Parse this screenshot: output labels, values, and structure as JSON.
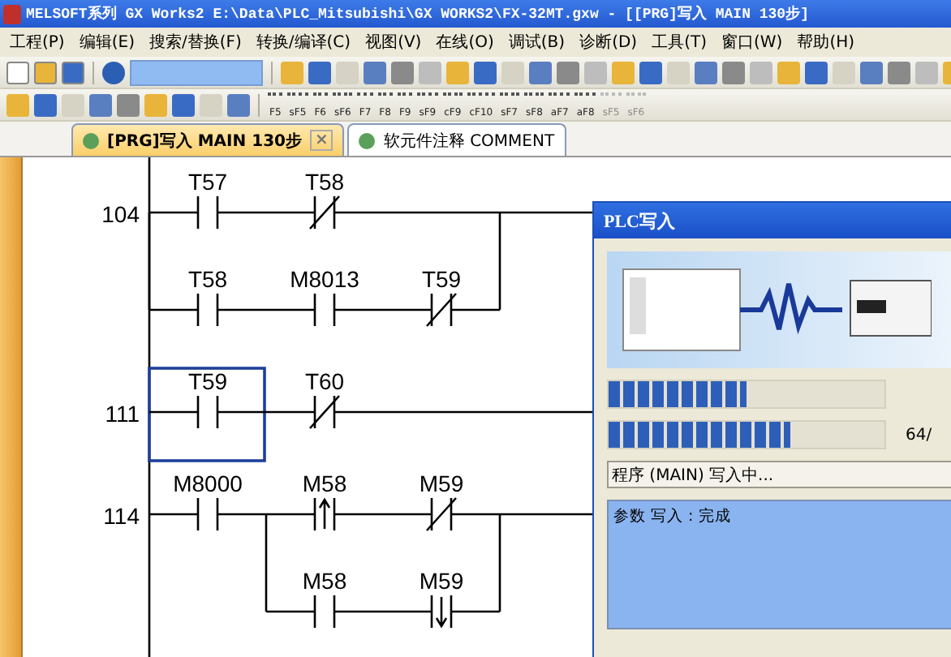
{
  "window": {
    "title": "MELSOFT系列 GX Works2 E:\\Data\\PLC_Mitsubishi\\GX WORKS2\\FX-32MT.gxw - [[PRG]写入 MAIN 130步]"
  },
  "menu": [
    "工程(P)",
    "编辑(E)",
    "搜索/替换(F)",
    "转换/编译(C)",
    "视图(V)",
    "在线(O)",
    "调试(B)",
    "诊断(D)",
    "工具(T)",
    "窗口(W)",
    "帮助(H)"
  ],
  "key_buttons": [
    {
      "label": "F5",
      "disabled": false
    },
    {
      "label": "sF5",
      "disabled": false
    },
    {
      "label": "F6",
      "disabled": false
    },
    {
      "label": "sF6",
      "disabled": false
    },
    {
      "label": "F7",
      "disabled": false
    },
    {
      "label": "F8",
      "disabled": false
    },
    {
      "label": "F9",
      "disabled": false
    },
    {
      "label": "sF9",
      "disabled": false
    },
    {
      "label": "cF9",
      "disabled": false
    },
    {
      "label": "cF10",
      "disabled": false
    },
    {
      "label": "sF7",
      "disabled": false
    },
    {
      "label": "sF8",
      "disabled": false
    },
    {
      "label": "aF7",
      "disabled": false
    },
    {
      "label": "aF8",
      "disabled": false
    },
    {
      "label": "sF5",
      "disabled": true
    },
    {
      "label": "sF6",
      "disabled": true
    }
  ],
  "tabs": [
    {
      "label": "[PRG]写入 MAIN 130步",
      "selected": true,
      "close": "×"
    },
    {
      "label": "软元件注释 COMMENT",
      "selected": false
    }
  ],
  "rungs": [
    {
      "step": "104",
      "rows": [
        [
          {
            "kind": "no",
            "label": "T57",
            "selected": false
          },
          {
            "kind": "nc",
            "label": "T58",
            "selected": false
          }
        ],
        [
          {
            "kind": "no",
            "label": "T58",
            "selected": false
          },
          {
            "kind": "no",
            "label": "M8013",
            "selected": false
          },
          {
            "kind": "nc",
            "label": "T59",
            "selected": false
          }
        ]
      ]
    },
    {
      "step": "111",
      "rows": [
        [
          {
            "kind": "no",
            "label": "T59",
            "selected": true
          },
          {
            "kind": "nc",
            "label": "T60",
            "selected": false
          }
        ]
      ]
    },
    {
      "step": "114",
      "rows": [
        [
          {
            "kind": "no",
            "label": "M8000",
            "selected": false
          },
          {
            "kind": "rise",
            "label": "M58",
            "selected": false
          },
          {
            "kind": "nc",
            "label": "M59",
            "selected": false
          }
        ],
        [
          {
            "kind": "skip"
          },
          {
            "kind": "no",
            "label": "M58",
            "selected": false
          },
          {
            "kind": "fall",
            "label": "M59",
            "selected": false
          }
        ]
      ]
    }
  ],
  "dialog": {
    "title": "PLC写入",
    "progress": [
      {
        "level": 0.5
      },
      {
        "level": 0.66
      }
    ],
    "count": "64/",
    "status": "程序 (MAIN) 写入中...",
    "log": "参数 写入 : 完成"
  }
}
